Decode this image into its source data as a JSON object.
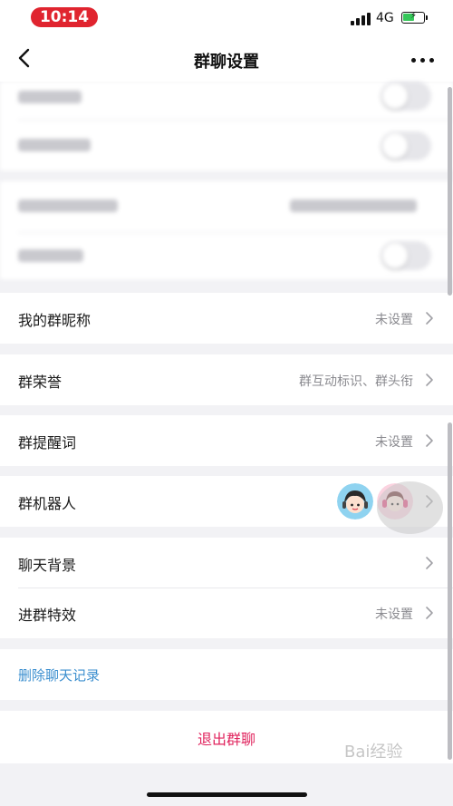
{
  "status_bar": {
    "time": "10:14",
    "network": "4G",
    "time_pill_color": "#e0242f",
    "battery_color": "#35c759"
  },
  "nav": {
    "back_icon": "chevron-left-icon",
    "title": "群聊设置",
    "more_icon": "more-dots-icon"
  },
  "settings": {
    "nickname": {
      "label": "我的群昵称",
      "value": "未设置"
    },
    "honor": {
      "label": "群荣誉",
      "value": "群互动标识、群头衔"
    },
    "reminder": {
      "label": "群提醒词",
      "value": "未设置"
    },
    "robot": {
      "label": "群机器人"
    },
    "background": {
      "label": "聊天背景"
    },
    "join_effect": {
      "label": "进群特效",
      "value": "未设置"
    },
    "delete_history": {
      "label": "删除聊天记录",
      "color": "#3c8fcf"
    },
    "exit_group": {
      "label": "退出群聊",
      "color": "#e0245e"
    }
  },
  "watermark": "Bai经验"
}
